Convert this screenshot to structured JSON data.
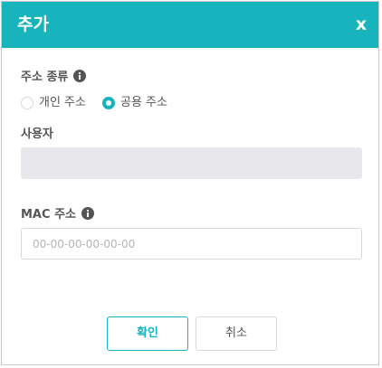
{
  "dialog": {
    "title": "추가",
    "close_label": "x"
  },
  "address_type": {
    "label": "주소 종류",
    "info_icon": "info-icon",
    "options": [
      {
        "label": "개인 주소",
        "selected": false
      },
      {
        "label": "공용 주소",
        "selected": true
      }
    ]
  },
  "user": {
    "label": "사용자",
    "value": ""
  },
  "mac_address": {
    "label": "MAC 주소",
    "info_icon": "info-icon",
    "value": "",
    "placeholder": "00-00-00-00-00-00"
  },
  "buttons": {
    "ok_label": "확인",
    "cancel_label": "취소"
  },
  "colors": {
    "accent": "#17b4bd",
    "readonly_bg": "#e8e8ec"
  }
}
